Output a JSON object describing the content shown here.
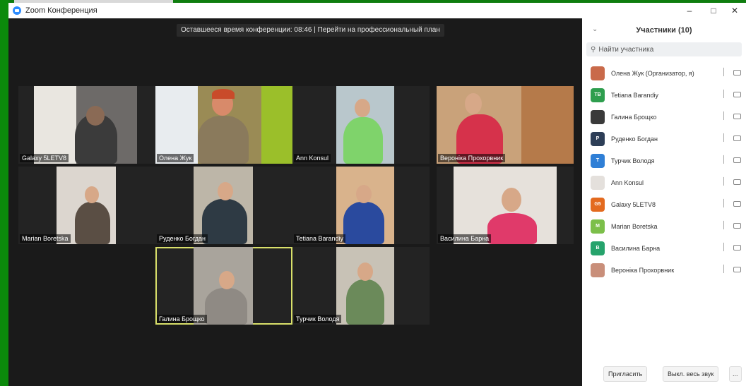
{
  "window": {
    "title": "Zoom Конференция",
    "min_icon": "minimize-icon",
    "max_icon": "maximize-icon",
    "close_icon": "close-icon"
  },
  "banner": {
    "text": "Оставшееся время конференции: 08:46 | Перейти на профессиональный план"
  },
  "tiles": [
    {
      "name": "Galaxy 5LETV8",
      "active": false
    },
    {
      "name": "Олена Жук",
      "active": false
    },
    {
      "name": "Ann Konsul",
      "active": false
    },
    {
      "name": "Вероніка Прохорвник",
      "active": false
    },
    {
      "name": "Marian Boretska",
      "active": false
    },
    {
      "name": "Руденко Богдан",
      "active": false
    },
    {
      "name": "Tetiana Barandiy",
      "active": false
    },
    {
      "name": "Василина Барна",
      "active": false
    },
    {
      "name": "Галина Брощко",
      "active": true
    },
    {
      "name": "Турчик Володя",
      "active": false
    }
  ],
  "panel": {
    "title": "Участники (10)",
    "search_placeholder": "Найти участника",
    "participants": [
      {
        "name": "Олена Жук (Организатор, я)",
        "initials": "",
        "color": "#c96a4a",
        "photo": true
      },
      {
        "name": "Tetiana Barandiy",
        "initials": "TB",
        "color": "#2e9e4e",
        "photo": false
      },
      {
        "name": "Галина Брощко",
        "initials": "",
        "color": "#3a3a3a",
        "photo": true
      },
      {
        "name": "Руденко Богдан",
        "initials": "P",
        "color": "#2d3e57",
        "photo": false
      },
      {
        "name": "Турчик Володя",
        "initials": "T",
        "color": "#2f7fd6",
        "photo": false
      },
      {
        "name": "Ann Konsul",
        "initials": "",
        "color": "#e4e0dc",
        "photo": true
      },
      {
        "name": "Galaxy 5LETV8",
        "initials": "G5",
        "color": "#e36a1f",
        "photo": false
      },
      {
        "name": "Marian Boretska",
        "initials": "M",
        "color": "#7cbf4a",
        "photo": false
      },
      {
        "name": "Василина Барна",
        "initials": "B",
        "color": "#26a36c",
        "photo": false
      },
      {
        "name": "Вероніка Прохорвник",
        "initials": "",
        "color": "#c98f7a",
        "photo": true
      }
    ],
    "invite_label": "Пригласить",
    "mute_all_label": "Выкл. весь звук",
    "more_label": "..."
  }
}
